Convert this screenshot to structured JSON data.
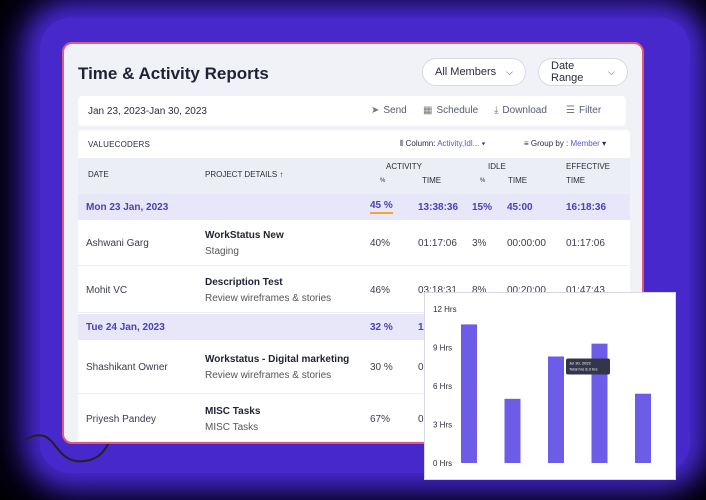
{
  "title": "Time & Activity Reports",
  "filters": {
    "members": "All Members",
    "range": "Date Range"
  },
  "toolbar": {
    "range": "Jan 23, 2023-Jan 30, 2023",
    "send": "Send",
    "schedule": "Schedule",
    "download": "Download",
    "filter": "Filter"
  },
  "table": {
    "brand": "VALUECODERS",
    "column_label": "Column:",
    "column_value": "Activity,Idl...",
    "group_label": "Group by :",
    "group_value": "Member",
    "headers": {
      "date": "DATE",
      "project": "PROJECT DETAILS ↑",
      "activity": "ACTIVITY",
      "activity_pct": "%",
      "activity_time": "TIME",
      "idle": "IDLE",
      "idle_pct": "%",
      "idle_time": "TIME",
      "effective": "EFFECTIVE",
      "effective_time": "TIME"
    },
    "groups": [
      {
        "date": "Mon 23 Jan, 2023",
        "activity_pct": "45 %",
        "activity_time": "13:38:36",
        "idle_pct": "15%",
        "idle_time": "45:00",
        "effective": "16:18:36"
      },
      {
        "date": "Tue 24 Jan, 2023",
        "activity_pct": "32 %",
        "activity_time": "12"
      }
    ],
    "rows": [
      {
        "name": "Ashwani Garg",
        "project": "WorkStatus New",
        "sub": "Staging",
        "act": "40%",
        "time": "01:17:06",
        "idle": "3%",
        "idle_time": "00:00:00",
        "eff": "01:17:06"
      },
      {
        "name": "Mohit VC",
        "project": "Description Test",
        "sub": "Review wireframes & stories",
        "act": "46%",
        "time": "03:18:31",
        "idle": "8%",
        "idle_time": "00:20:00",
        "eff": "01:47:43"
      },
      {
        "name": "Shashikant Owner",
        "project": "Workstatus - Digital marketing",
        "sub": "Review wireframes & stories",
        "act": "30 %",
        "time": "0"
      },
      {
        "name": "Priyesh Pandey",
        "project": "MISC Tasks",
        "sub": "MISC Tasks",
        "act": "67%",
        "time": "0"
      }
    ]
  },
  "colors": {
    "accent": "#6c5ce7",
    "group_bg": "#e8e6f9",
    "glow": "#4a2bd6"
  },
  "chart_data": {
    "type": "bar",
    "values": [
      10.8,
      5.0,
      8.3,
      9.3,
      5.4
    ],
    "yticks": [
      "12 Hrs",
      "9 Hrs",
      "6 Hrs",
      "3 Hrs",
      "0 Hrs"
    ],
    "ylim": [
      0,
      12
    ],
    "tooltip": {
      "line1": "Jul 30, 2022",
      "line2": "Total hrs 8.3 hrs"
    }
  }
}
